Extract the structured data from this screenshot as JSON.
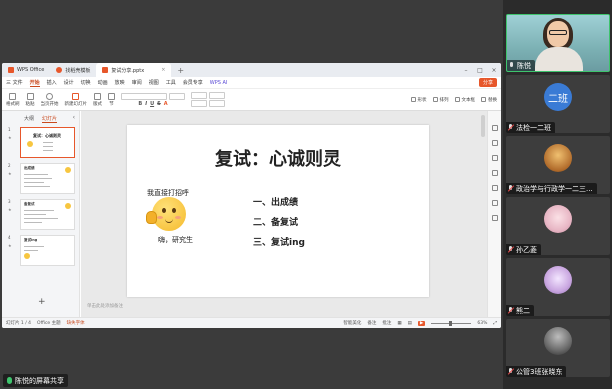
{
  "wps": {
    "tabs": [
      {
        "label": "WPS Office"
      },
      {
        "label": "找稻壳模板"
      },
      {
        "label": "复试分享.pptx"
      }
    ],
    "menu": {
      "file": "三 文件",
      "items": [
        "开始",
        "插入",
        "设计",
        "切换",
        "动画",
        "放映",
        "审阅",
        "视图",
        "工具",
        "会员专享"
      ],
      "ai": "WPS AI",
      "share": "分享"
    },
    "ribbon": {
      "paste_group": [
        "格式刷",
        "粘贴"
      ],
      "play_group": "当页开始",
      "new_slide": "新建幻灯片",
      "layout": "版式",
      "section": "节",
      "right": [
        "形状",
        "排列",
        "文本框",
        "替换"
      ]
    },
    "sidebar": {
      "tabs": [
        "大纲",
        "幻灯片"
      ]
    },
    "thumbnails": [
      {
        "num": "1",
        "title": "复试：心诚则灵"
      },
      {
        "num": "2",
        "title": "出成绩"
      },
      {
        "num": "3",
        "title": "备复试"
      },
      {
        "num": "4",
        "title": "复试ing"
      }
    ],
    "slide": {
      "title": "复试：心诚则灵",
      "emoji_caption": "我直接打招呼",
      "emoji_sub": "嗨，研究生",
      "items": [
        "一、出成绩",
        "二、备复试",
        "三、复试ing"
      ]
    },
    "notes_placeholder": "单击此处添加备注",
    "status": {
      "slide_count": "幻灯片 1 / 4",
      "theme": "Office 主题",
      "missing_font": "缺失字体",
      "beautify": "智能美化",
      "notes": "备注",
      "comments": "批注",
      "zoom": "63%"
    }
  },
  "share_label": "陈悦的屏幕共享",
  "participants": [
    {
      "name": "陈悦",
      "type": "camera"
    },
    {
      "name": "法检一二班",
      "avatar_text": "二班",
      "avatar_color": "#3a7bd5"
    },
    {
      "name": "政治学与行政学一二三...",
      "avatar_color": "#c98a4a"
    },
    {
      "name": "孙乙菱",
      "avatar_color": "#e8b7c5"
    },
    {
      "name": "熊二",
      "avatar_color": "#c9a6e0"
    },
    {
      "name": "公管3班张晓东",
      "avatar_color": "#7a7a7a"
    }
  ],
  "colors": {
    "accent": "#e7572b",
    "active_border": "#3ec46d"
  }
}
